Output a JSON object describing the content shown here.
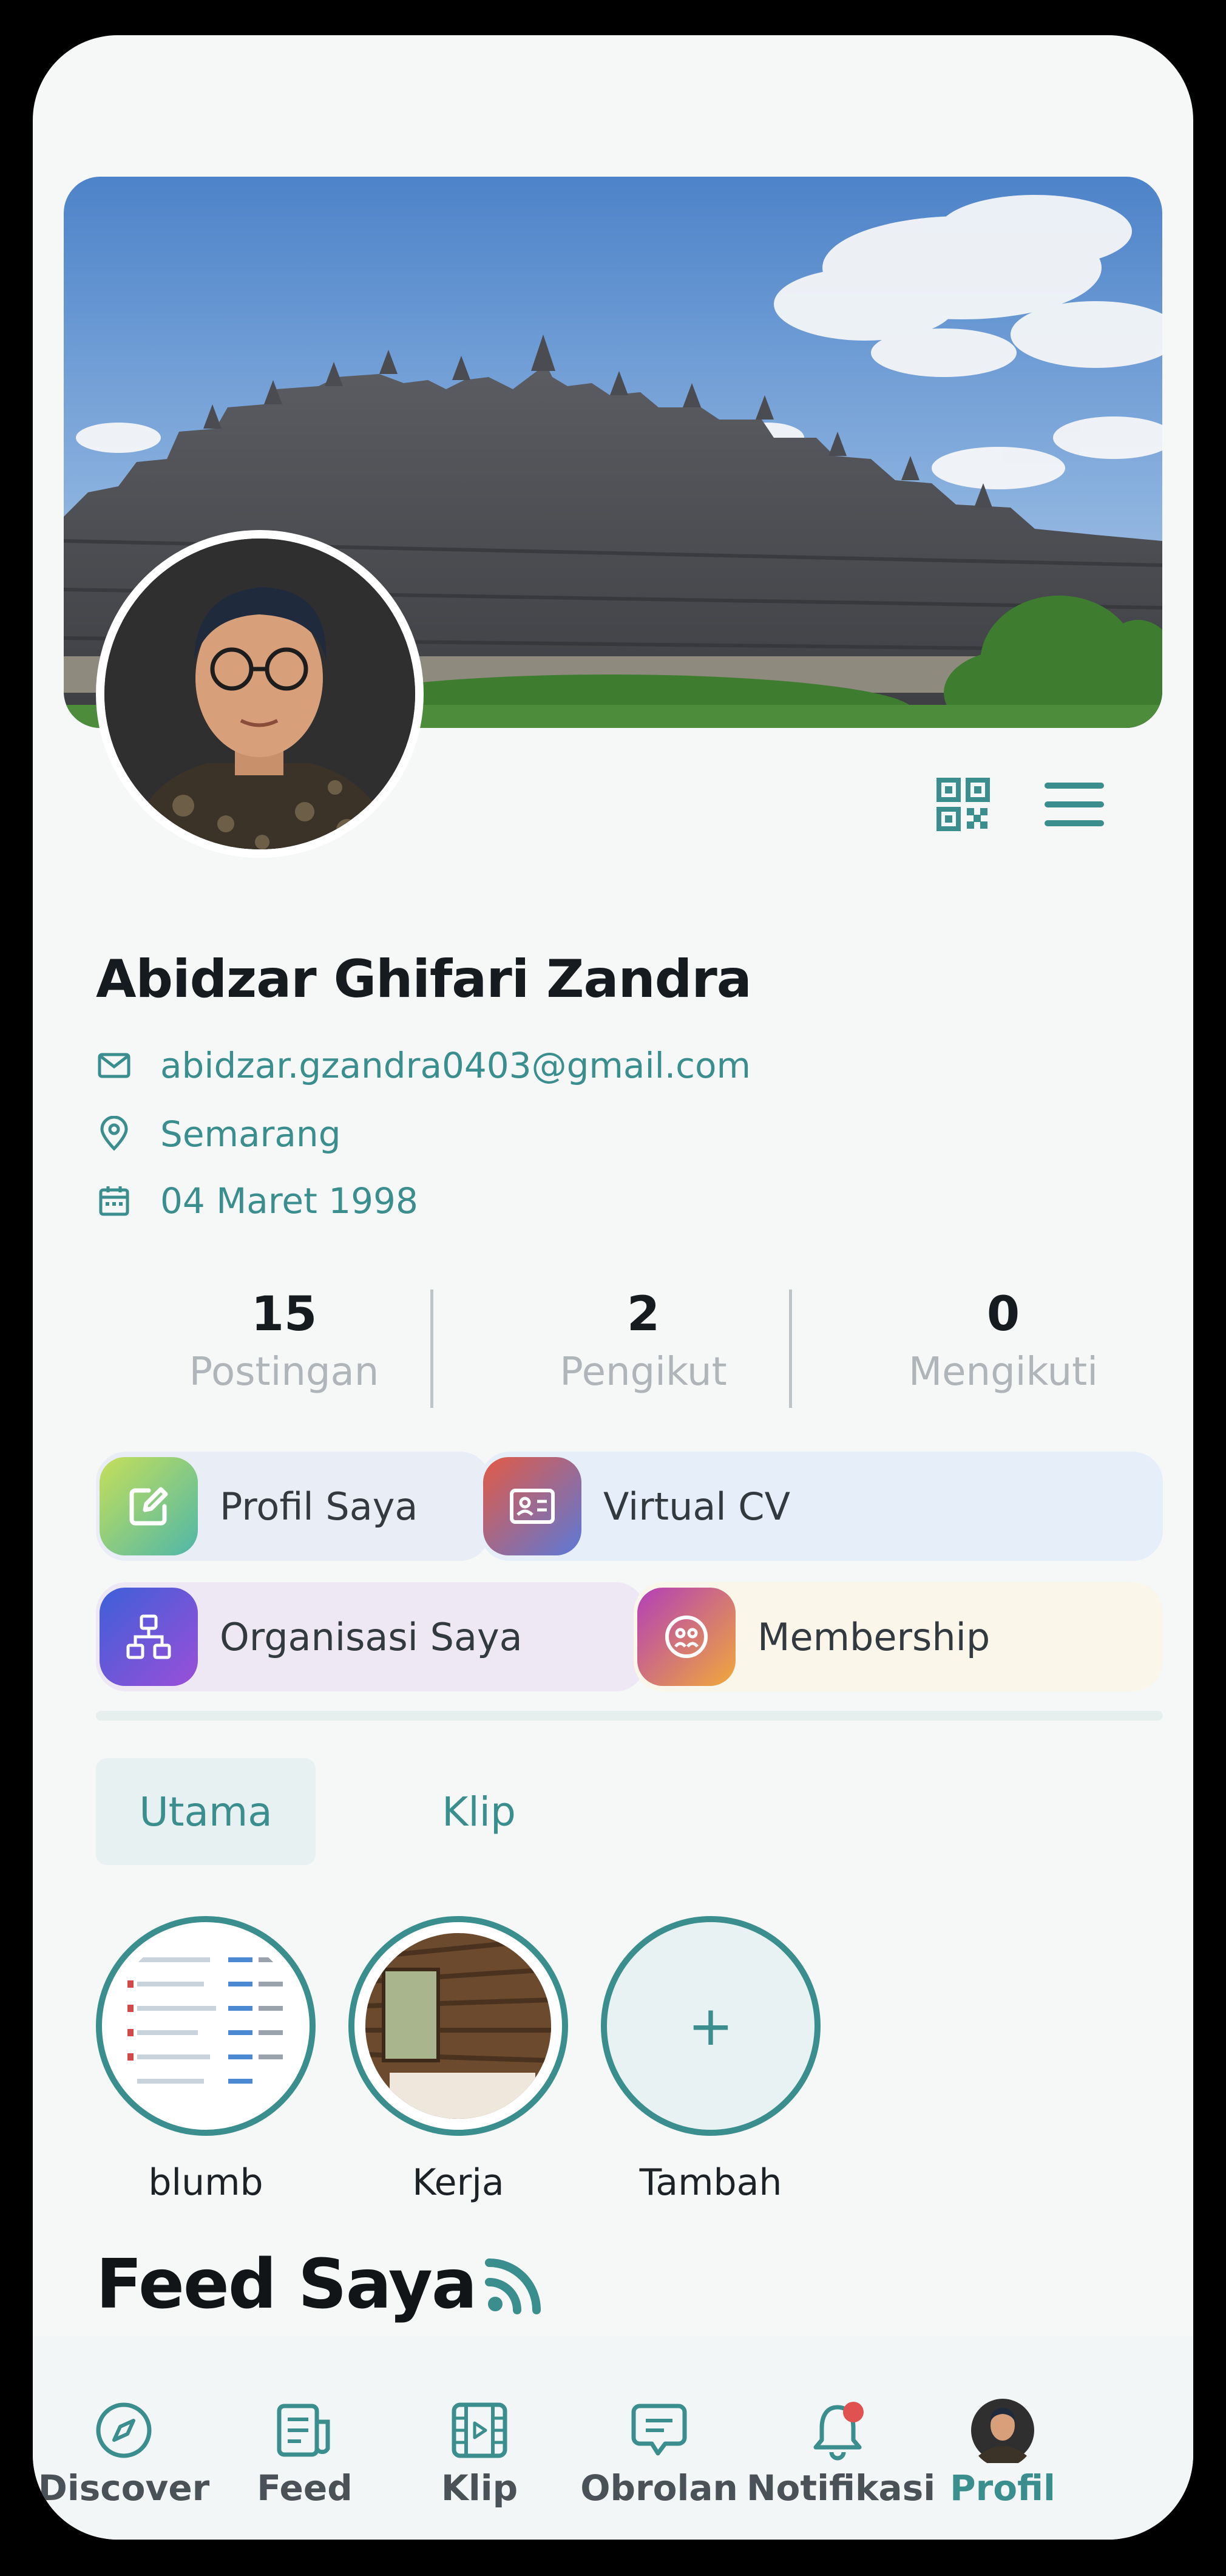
{
  "profile": {
    "name": "Abidzar Ghifari Zandra",
    "email": "abidzar.gzandra0403@gmail.com",
    "location": "Semarang",
    "birth_date": "04 Maret 1998"
  },
  "stats": [
    {
      "value": "15",
      "label": "Postingan"
    },
    {
      "value": "2",
      "label": "Pengikut"
    },
    {
      "value": "0",
      "label": "Mengikuti"
    }
  ],
  "actions": {
    "profil_saya": "Profil Saya",
    "virtual_cv": "Virtual CV",
    "organisasi_saya": "Organisasi Saya",
    "membership": "Membership"
  },
  "tabs": {
    "utama": "Utama",
    "klip": "Klip"
  },
  "stories": [
    {
      "label": "blumb"
    },
    {
      "label": "Kerja"
    },
    {
      "label": "Tambah",
      "symbol": "+"
    }
  ],
  "feed": {
    "title": "Feed Saya"
  },
  "bottom_nav": [
    {
      "label": "Discover",
      "icon": "compass-icon"
    },
    {
      "label": "Feed",
      "icon": "feed-icon"
    },
    {
      "label": "Klip",
      "icon": "film-icon"
    },
    {
      "label": "Obrolan",
      "icon": "chat-icon"
    },
    {
      "label": "Notifikasi",
      "icon": "bell-icon"
    },
    {
      "label": "Profil",
      "icon": "avatar-icon",
      "active": true
    }
  ],
  "colors": {
    "accent": "#3a8e8d",
    "text_dark": "#161b1f",
    "muted": "#b0b5b9",
    "notification_dot": "#e0524f"
  }
}
